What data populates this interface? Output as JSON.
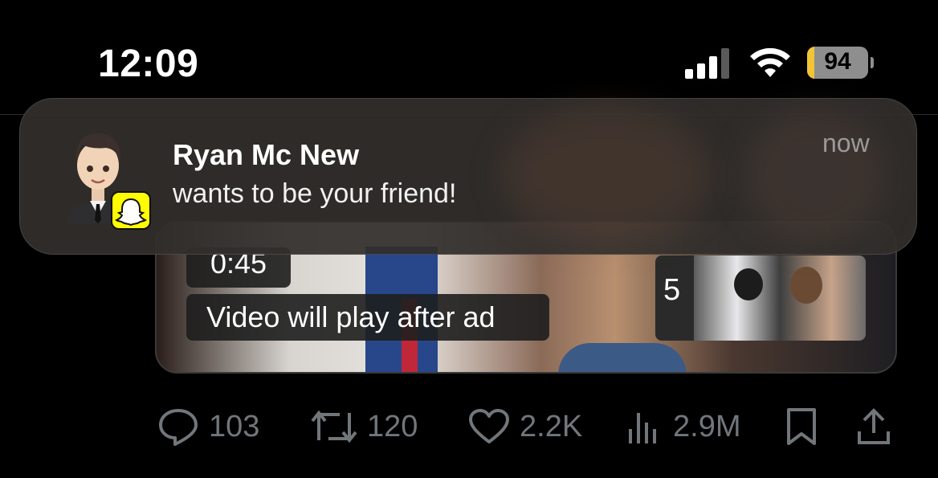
{
  "status_bar": {
    "time": "12:09",
    "battery_level": "94",
    "battery_fraction": 0.94
  },
  "media": {
    "ad_countdown": "0:45",
    "ad_message": "Video will play after ad",
    "next_up_count": "5"
  },
  "notification": {
    "app_icon": "snapchat-ghost-icon",
    "sender": "Ryan Mc New",
    "message": "wants to be your friend!",
    "time": "now"
  },
  "actions": {
    "replies": "103",
    "reposts": "120",
    "likes": "2.2K",
    "views": "2.9M"
  },
  "colors": {
    "background": "#000000",
    "snapchat": "#fffc00",
    "muted": "#71767b"
  }
}
